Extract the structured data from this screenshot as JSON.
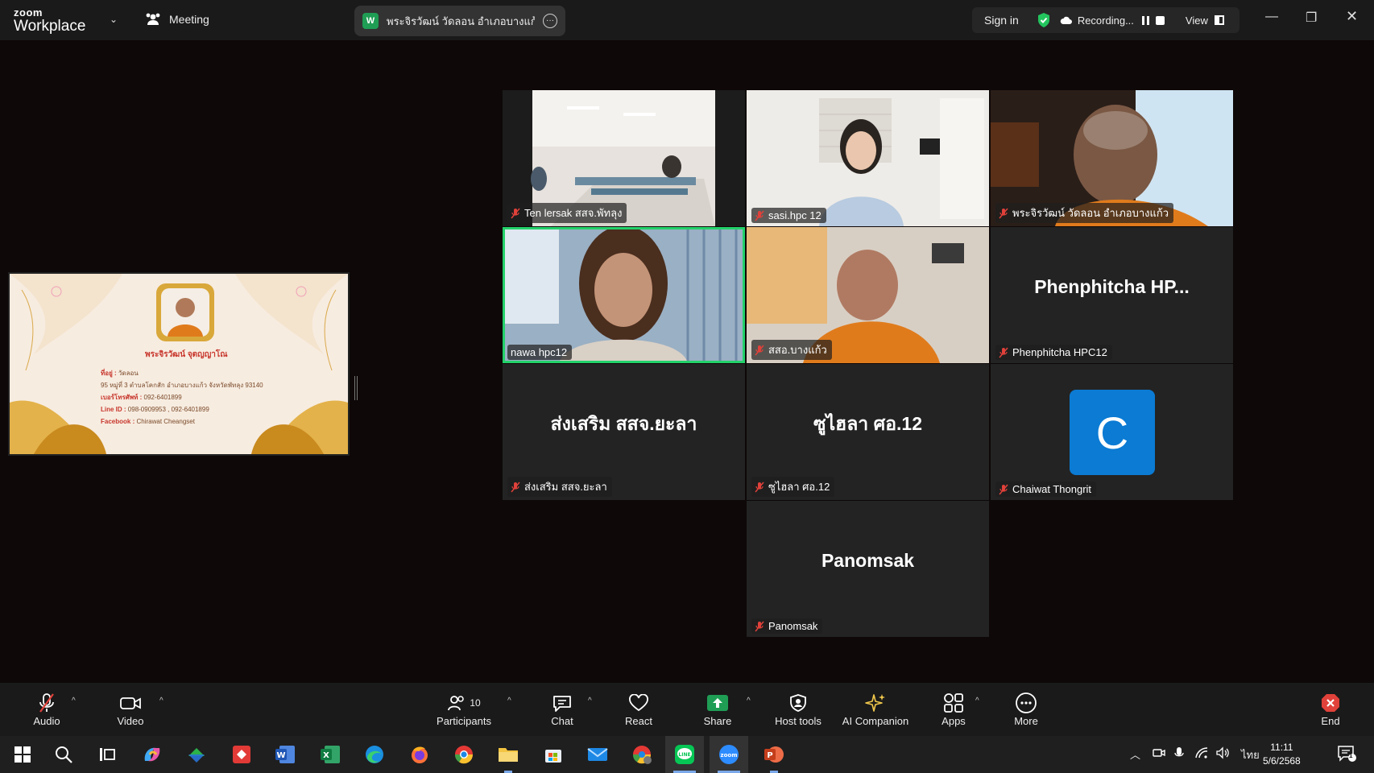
{
  "app": {
    "brand_top": "zoom",
    "brand_bottom": "Workplace",
    "meeting_label": "Meeting",
    "share_badge": "W",
    "share_title": "พระจิรวัฒน์ วัดลอน อำเภอบางแก้ว's s"
  },
  "header": {
    "signin": "Sign in",
    "recording": "Recording...",
    "view": "View"
  },
  "slide": {
    "name_line": "พระจิรวัฒน์ จุตญญาโณ",
    "addr_label": "ที่อยู่ :",
    "addr_value": "วัดลอน",
    "addr_line2": "95 หมู่ที่ 3 ตำบลโคกสัก อำเภอบางแก้ว จังหวัดพัทลุง 93140",
    "phone_label": "เบอร์โทรศัพท์ :",
    "phone_value": "092-6401899",
    "line_label": "Line ID :",
    "line_value": "098-0909953 , 092-6401899",
    "fb_label": "Facebook :",
    "fb_value": "Chirawat Cheangset"
  },
  "tiles": [
    {
      "name": "Ten lersak สสจ.พัทลุง",
      "display": ""
    },
    {
      "name": "sasi.hpc 12",
      "display": ""
    },
    {
      "name": "พระจิรวัฒน์ วัดลอน อำเภอบางแก้ว",
      "display": ""
    },
    {
      "name": "nawa hpc12",
      "display": ""
    },
    {
      "name": "สสอ.บางแก้ว",
      "display": ""
    },
    {
      "name": "Phenphitcha HPC12",
      "display": "Phenphitcha  HP..."
    },
    {
      "name": "ส่งเสริม สสจ.ยะลา",
      "display": "ส่งเสริม สสจ.ยะลา"
    },
    {
      "name": "ซูไฮลา ศอ.12",
      "display": "ซูไฮลา ศอ.12"
    },
    {
      "name": "Chaiwat Thongrit",
      "display": "C"
    },
    {
      "name": "Panomsak",
      "display": "Panomsak"
    }
  ],
  "toolbar": {
    "audio": "Audio",
    "video": "Video",
    "participants": "Participants",
    "participant_count": "10",
    "chat": "Chat",
    "react": "React",
    "share": "Share",
    "host_tools": "Host tools",
    "ai_companion": "AI Companion",
    "apps": "Apps",
    "more": "More",
    "end": "End"
  },
  "taskbar": {
    "lang": "ไทย",
    "time": "11:11",
    "date": "5/6/2568",
    "notif_count": "1"
  },
  "colors": {
    "active_speaker": "#23d16a",
    "share_green": "#1f9d55",
    "avatar_blue": "#0b7bd4",
    "mute_red": "#e0413a"
  }
}
